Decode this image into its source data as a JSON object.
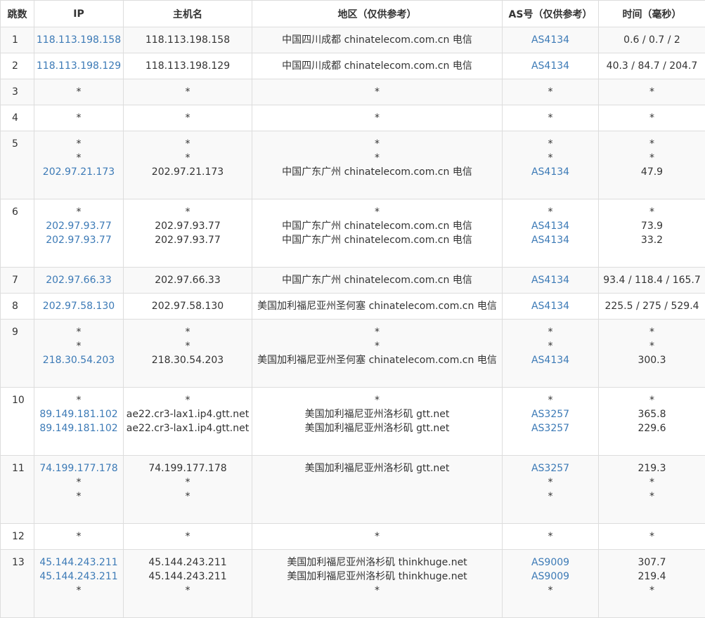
{
  "table": {
    "headers": [
      "跳数",
      "IP",
      "主机名",
      "地区（仅供参考）",
      "AS号（仅供参考）",
      "时间（毫秒）"
    ],
    "rows": [
      {
        "hop": "1",
        "lines": [
          {
            "ip": "118.113.198.158",
            "host": "118.113.198.158",
            "region": "中国四川成都 chinatelecom.com.cn 电信",
            "as": "AS4134",
            "time": "0.6 / 0.7 / 2"
          }
        ]
      },
      {
        "hop": "2",
        "lines": [
          {
            "ip": "118.113.198.129",
            "host": "118.113.198.129",
            "region": "中国四川成都 chinatelecom.com.cn 电信",
            "as": "AS4134",
            "time": "40.3 / 84.7 / 204.7"
          }
        ]
      },
      {
        "hop": "3",
        "lines": [
          {
            "ip": "*",
            "host": "*",
            "region": "*",
            "as": "*",
            "time": "*"
          }
        ]
      },
      {
        "hop": "4",
        "lines": [
          {
            "ip": "*",
            "host": "*",
            "region": "*",
            "as": "*",
            "time": "*"
          }
        ]
      },
      {
        "hop": "5",
        "lines": [
          {
            "ip": "*",
            "host": "*",
            "region": "*",
            "as": "*",
            "time": "*"
          },
          {
            "ip": "*",
            "host": "*",
            "region": "*",
            "as": "*",
            "time": "*"
          },
          {
            "ip": "202.97.21.173",
            "host": "202.97.21.173",
            "region": "中国广东广州 chinatelecom.com.cn 电信",
            "as": "AS4134",
            "time": "47.9"
          }
        ]
      },
      {
        "hop": "6",
        "lines": [
          {
            "ip": "*",
            "host": "*",
            "region": "*",
            "as": "*",
            "time": "*"
          },
          {
            "ip": "202.97.93.77",
            "host": "202.97.93.77",
            "region": "中国广东广州 chinatelecom.com.cn 电信",
            "as": "AS4134",
            "time": "73.9"
          },
          {
            "ip": "202.97.93.77",
            "host": "202.97.93.77",
            "region": "中国广东广州 chinatelecom.com.cn 电信",
            "as": "AS4134",
            "time": "33.2"
          }
        ]
      },
      {
        "hop": "7",
        "lines": [
          {
            "ip": "202.97.66.33",
            "host": "202.97.66.33",
            "region": "中国广东广州 chinatelecom.com.cn 电信",
            "as": "AS4134",
            "time": "93.4 / 118.4 / 165.7"
          }
        ]
      },
      {
        "hop": "8",
        "lines": [
          {
            "ip": "202.97.58.130",
            "host": "202.97.58.130",
            "region": "美国加利福尼亚州圣何塞 chinatelecom.com.cn 电信",
            "as": "AS4134",
            "time": "225.5 / 275 / 529.4"
          }
        ]
      },
      {
        "hop": "9",
        "lines": [
          {
            "ip": "*",
            "host": "*",
            "region": "*",
            "as": "*",
            "time": "*"
          },
          {
            "ip": "*",
            "host": "*",
            "region": "*",
            "as": "*",
            "time": "*"
          },
          {
            "ip": "218.30.54.203",
            "host": "218.30.54.203",
            "region": "美国加利福尼亚州圣何塞 chinatelecom.com.cn 电信",
            "as": "AS4134",
            "time": "300.3"
          }
        ]
      },
      {
        "hop": "10",
        "lines": [
          {
            "ip": "*",
            "host": "*",
            "region": "*",
            "as": "*",
            "time": "*"
          },
          {
            "ip": "89.149.181.102",
            "host": "ae22.cr3-lax1.ip4.gtt.net",
            "region": "美国加利福尼亚州洛杉矶 gtt.net",
            "as": "AS3257",
            "time": "365.8"
          },
          {
            "ip": "89.149.181.102",
            "host": "ae22.cr3-lax1.ip4.gtt.net",
            "region": "美国加利福尼亚州洛杉矶 gtt.net",
            "as": "AS3257",
            "time": "229.6"
          }
        ]
      },
      {
        "hop": "11",
        "lines": [
          {
            "ip": "74.199.177.178",
            "host": "74.199.177.178",
            "region": "美国加利福尼亚州洛杉矶 gtt.net",
            "as": "AS3257",
            "time": "219.3"
          },
          {
            "ip": "*",
            "host": "*",
            "region": "",
            "as": "*",
            "time": "*"
          },
          {
            "ip": "*",
            "host": "*",
            "region": "",
            "as": "*",
            "time": "*"
          }
        ]
      },
      {
        "hop": "12",
        "lines": [
          {
            "ip": "*",
            "host": "*",
            "region": "*",
            "as": "*",
            "time": "*"
          }
        ]
      },
      {
        "hop": "13",
        "lines": [
          {
            "ip": "45.144.243.211",
            "host": "45.144.243.211",
            "region": "美国加利福尼亚州洛杉矶 thinkhuge.net",
            "as": "AS9009",
            "time": "307.7"
          },
          {
            "ip": "45.144.243.211",
            "host": "45.144.243.211",
            "region": "美国加利福尼亚州洛杉矶 thinkhuge.net",
            "as": "AS9009",
            "time": "219.4"
          },
          {
            "ip": "*",
            "host": "*",
            "region": "*",
            "as": "*",
            "time": "*"
          }
        ]
      }
    ]
  },
  "colors": {
    "link": "#3c7ab6",
    "text": "#333333",
    "border": "#dddddd",
    "stripe": "#f9f9f9"
  }
}
